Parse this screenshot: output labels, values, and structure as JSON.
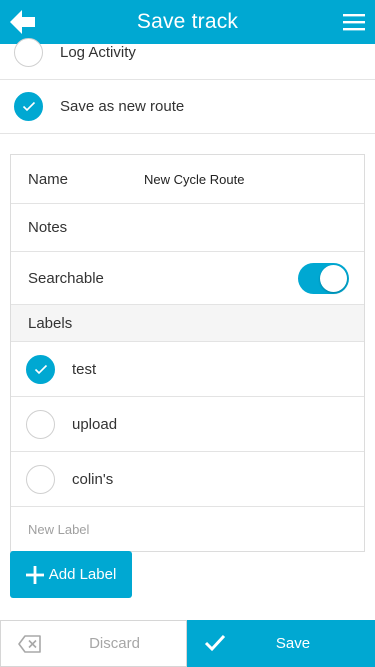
{
  "header": {
    "title": "Save track",
    "back_icon": "arrow-left-icon",
    "menu_icon": "hamburger-menu-icon",
    "color": "#00a8d2"
  },
  "options": [
    {
      "label": "Log Activity",
      "checked": false
    },
    {
      "label": "Save as new route",
      "checked": true
    }
  ],
  "form": {
    "name_label": "Name",
    "name_value": "New Cycle Route",
    "notes_label": "Notes",
    "searchable_label": "Searchable",
    "searchable_on": true,
    "labels_header": "Labels",
    "labels": [
      {
        "label": "test",
        "checked": true
      },
      {
        "label": "upload",
        "checked": false
      },
      {
        "label": "colin's",
        "checked": false
      }
    ],
    "new_label_placeholder": "New Label"
  },
  "add_label": {
    "label": "Add Label",
    "icon": "plus-icon"
  },
  "footer": {
    "discard_label": "Discard",
    "discard_icon": "backspace-icon",
    "save_label": "Save",
    "save_icon": "checkmark-icon"
  }
}
